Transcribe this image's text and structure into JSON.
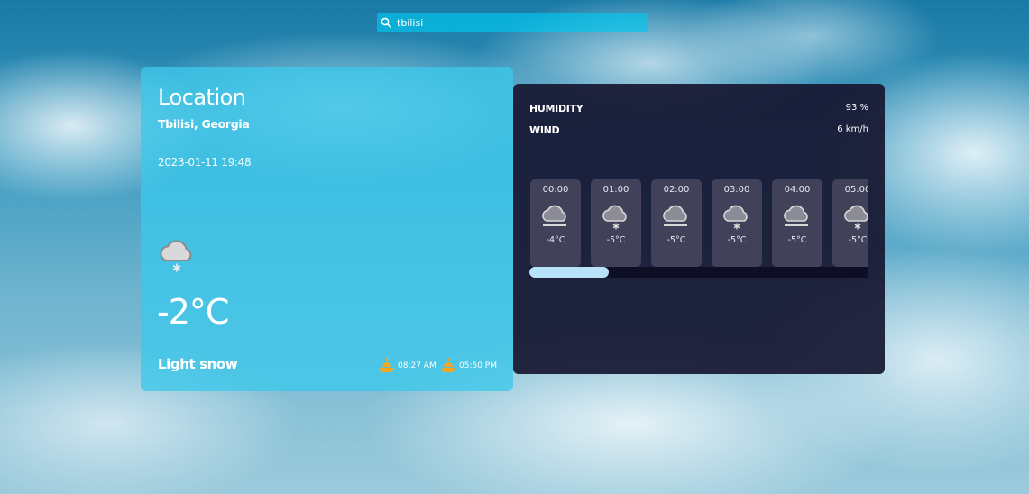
{
  "search": {
    "value": "tbilisi",
    "icon": "search-icon"
  },
  "current": {
    "title": "Location",
    "location": "Tbilisi, Georgia",
    "datetime": "2023-01-11 19:48",
    "temperature": "-2°C",
    "condition": "Light snow",
    "icon": "snow-cloud-icon",
    "sunrise": "08:27 AM",
    "sunset": "05:50 PM"
  },
  "details": {
    "humidity_label": "HUMIDITY",
    "humidity_value": "93 %",
    "wind_label": "WIND",
    "wind_value": "6 km/h"
  },
  "hourly": [
    {
      "time": "00:00",
      "temp": "-4°C",
      "icon": "fog-cloud-icon"
    },
    {
      "time": "01:00",
      "temp": "-5°C",
      "icon": "snow-cloud-icon"
    },
    {
      "time": "02:00",
      "temp": "-5°C",
      "icon": "fog-cloud-icon"
    },
    {
      "time": "03:00",
      "temp": "-5°C",
      "icon": "snow-cloud-icon"
    },
    {
      "time": "04:00",
      "temp": "-5°C",
      "icon": "fog-cloud-icon"
    },
    {
      "time": "05:00",
      "temp": "-5°C",
      "icon": "snow-cloud-icon"
    }
  ],
  "colors": {
    "main_card": "#3cc8eb",
    "details_card": "#18183200",
    "hour_tile": "#41415a",
    "scroll_thumb": "#b8e2f8",
    "sun_icon": "#f5a623"
  }
}
